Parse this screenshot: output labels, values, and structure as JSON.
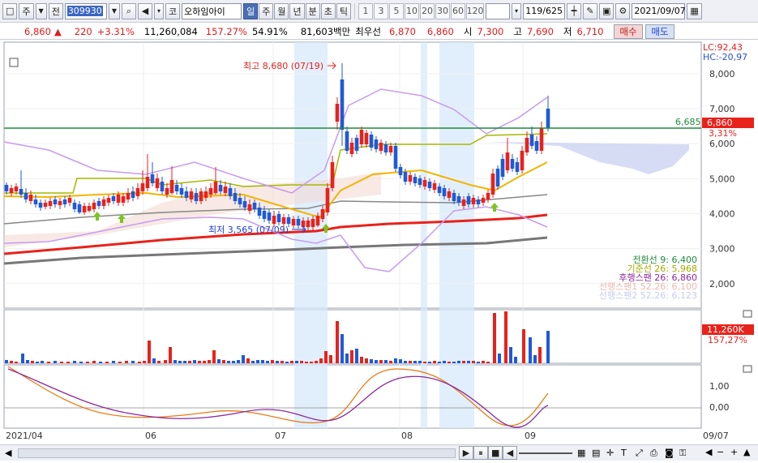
{
  "toolbar": {
    "type_label": "주",
    "market_label": "전",
    "stock_code": "309930",
    "market_tag": "코",
    "stock_name": "오하임아이",
    "period_buttons": [
      "일",
      "주",
      "월",
      "년",
      "분",
      "초",
      "틱"
    ],
    "active_period": "일",
    "interval_buttons": [
      "1",
      "3",
      "5",
      "10",
      "20",
      "30",
      "60",
      "120"
    ],
    "count_display": "119/625",
    "date_value": "2021/09/07"
  },
  "quote": {
    "price": "6,860",
    "change_arrow": "▲",
    "change": "220",
    "change_pct": "+3.31%",
    "volume": "11,260,084",
    "volume_ratio": "157.27%",
    "turnover": "54.91%",
    "amount": "81,603백만",
    "best_ask_label": "최우선",
    "best_ask": "6,870",
    "best_bid": "6,860",
    "open_label": "시",
    "open": "7,300",
    "high_label": "고",
    "high": "7,690",
    "low_label": "저",
    "low": "6,710",
    "buy_label": "매수",
    "sell_label": "매도"
  },
  "chart_data": {
    "type": "candlestick",
    "x_labels": [
      "2021/04",
      "06",
      "07",
      "08",
      "09",
      "09/07"
    ],
    "y_ticks": [
      2000,
      3000,
      4000,
      5000,
      6000,
      7000,
      8000
    ],
    "ylim": [
      1300,
      8900
    ],
    "top_right_info": [
      "LC:92,43",
      "HC:-20,97"
    ],
    "current_price_tag": "6,860",
    "current_pct_tag": "3,31%",
    "reference_line": {
      "label": "6,685",
      "value": 6685,
      "color": "#1f8a3a"
    },
    "annotations": {
      "high": "최고 8,680 (07/19)",
      "low": "최저 3,565 (07/09)"
    },
    "legend": [
      {
        "label": "전환선 9: 6,400",
        "color": "#1f8a3a"
      },
      {
        "label": "기준선 26: 5,968",
        "color": "#a6a800"
      },
      {
        "label": "후행스팬 26: 6,860",
        "color": "#8b2a9c"
      },
      {
        "label": "선행스팬1 52,26: 6,100",
        "color": "#e9b8ad"
      },
      {
        "label": "선행스팬2 52,26: 6,123",
        "color": "#c5cdef"
      }
    ],
    "volume_panel": {
      "value_tag": "11,260K",
      "pct_tag": "157,27%"
    },
    "oscillator_panel": {
      "ticks": [
        "1,00",
        "0,00"
      ]
    },
    "colors": {
      "up": "#e8221b",
      "down": "#1f5ad6",
      "bollinger": "#c79bef",
      "ma_long": "#e8221b",
      "ma_gray": "#777777",
      "ma_yellow": "#f2b400",
      "ma_olive": "#a6b800",
      "highlight": "#d7e9fb"
    }
  }
}
